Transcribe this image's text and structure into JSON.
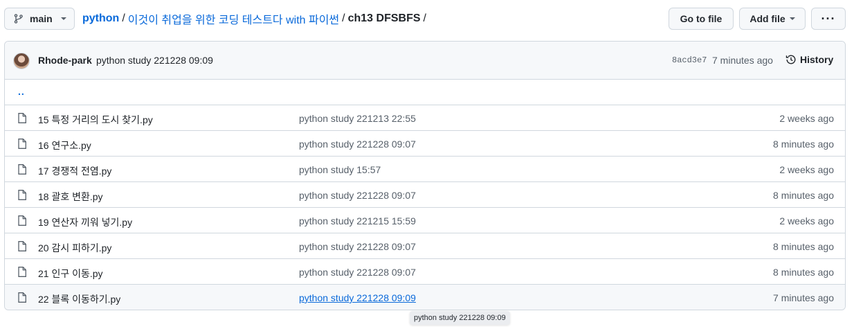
{
  "branch": {
    "name": "main"
  },
  "breadcrumb": {
    "repo": "python",
    "folder": "이것이 취업을 위한 코딩 테스트다 with 파이썬",
    "current": "ch13 DFSBFS",
    "sep": "/"
  },
  "actions": {
    "goto_label": "Go to file",
    "add_label": "Add file",
    "more_label": "···"
  },
  "latest_commit": {
    "author": "Rhode-park",
    "message": "python study 221228 09:09",
    "sha": "8acd3e7",
    "age": "7 minutes ago",
    "history_label": "History"
  },
  "parent_link": "..",
  "files": [
    {
      "name": "15 특정 거리의 도시 찾기.py",
      "message": "python study 221213 22:55",
      "age": "2 weeks ago"
    },
    {
      "name": "16 연구소.py",
      "message": "python study 221228 09:07",
      "age": "8 minutes ago"
    },
    {
      "name": "17 경쟁적 전염.py",
      "message": "python study 15:57",
      "age": "2 weeks ago"
    },
    {
      "name": "18 괄호 변환.py",
      "message": "python study 221228 09:07",
      "age": "8 minutes ago"
    },
    {
      "name": "19 연산자 끼워 넣기.py",
      "message": "python study 221215 15:59",
      "age": "2 weeks ago"
    },
    {
      "name": "20 감시 피하기.py",
      "message": "python study 221228 09:07",
      "age": "8 minutes ago"
    },
    {
      "name": "21 인구 이동.py",
      "message": "python study 221228 09:07",
      "age": "8 minutes ago"
    },
    {
      "name": "22 블록 이동하기.py",
      "message": "python study 221228 09:09",
      "age": "7 minutes ago"
    }
  ],
  "tooltip": "python study 221228 09:09",
  "colors": {
    "link": "#0969da",
    "muted": "#57606a",
    "border": "#d0d7de",
    "header_bg": "#f6f8fa"
  }
}
